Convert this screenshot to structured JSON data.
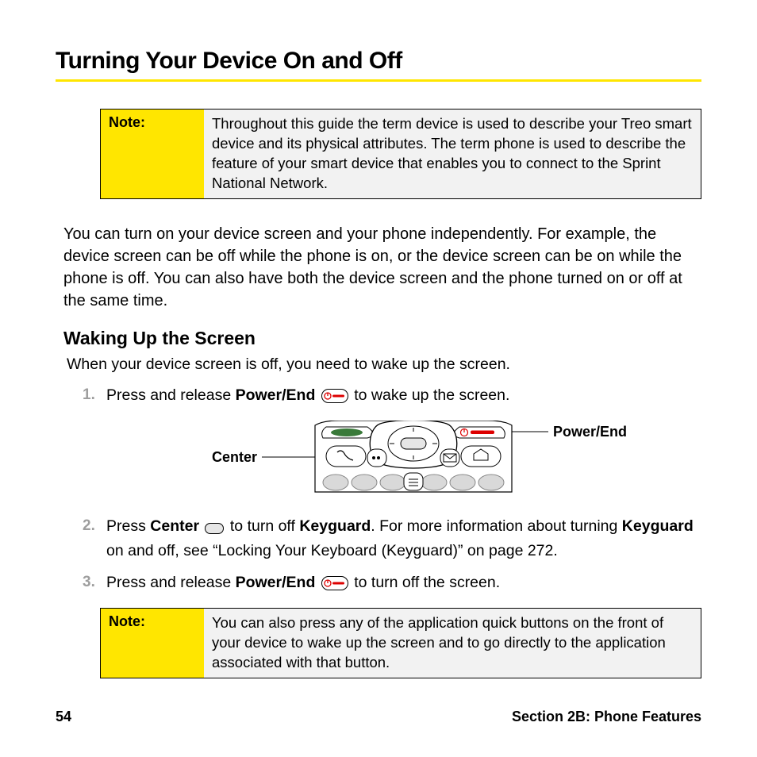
{
  "title": "Turning Your Device On and Off",
  "note1": {
    "label": "Note:",
    "text": "Throughout this guide the term device is used to describe your Treo smart device and its physical attributes. The term phone is used to describe the feature of your smart device that enables you to connect to the Sprint National Network."
  },
  "intro": "You can turn on your device screen and your phone independently. For example, the device screen can be off while the phone is on, or the device screen can be on while the phone is off. You can also have both the device screen and the phone turned on or off at the same time.",
  "subhead": "Waking Up the Screen",
  "lead": "When your device screen is off, you need to wake up the screen.",
  "steps": {
    "s1_a": "Press and release ",
    "s1_b": "Power/End",
    "s1_c": " to wake up the screen.",
    "s2_a": "Press ",
    "s2_b": "Center",
    "s2_c": " to turn off ",
    "s2_d": "Keyguard",
    "s2_e": ". For more information about turning ",
    "s2_f": "Keyguard",
    "s2_g": " on and off, see “Locking Your Keyboard (Keyguard)” on page 272.",
    "s3_a": "Press and release ",
    "s3_b": "Power/End",
    "s3_c": " to turn off the screen."
  },
  "diagram": {
    "left_label": "Center",
    "right_label": "Power/End"
  },
  "note2": {
    "label": "Note:",
    "text": "You can also press any of the application quick buttons on the front of your device to wake up  the screen and to go directly to the application associated with that button."
  },
  "footer": {
    "page_number": "54",
    "section": "Section 2B: Phone Features"
  }
}
